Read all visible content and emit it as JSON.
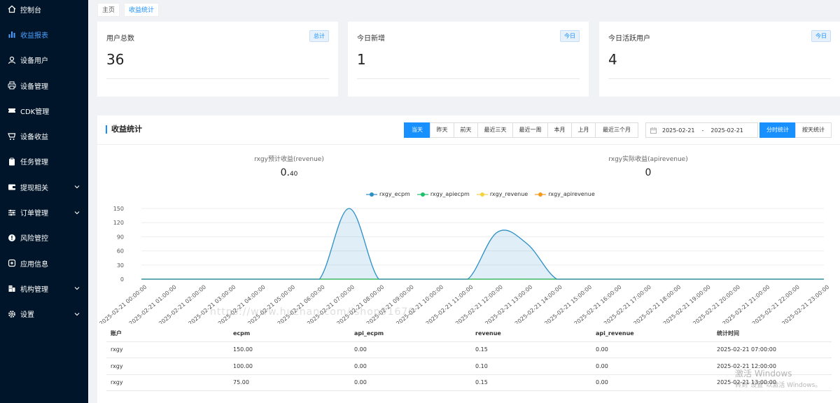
{
  "sidebar": {
    "items": [
      {
        "label": "控制台",
        "icon": "home-icon"
      },
      {
        "label": "收益报表",
        "icon": "bar-chart-icon",
        "active": true
      },
      {
        "label": "设备用户",
        "icon": "user-icon"
      },
      {
        "label": "设备管理",
        "icon": "printer-icon"
      },
      {
        "label": "CDK管理",
        "icon": "ticket-icon"
      },
      {
        "label": "设备收益",
        "icon": "cart-icon"
      },
      {
        "label": "任务管理",
        "icon": "clipboard-icon"
      },
      {
        "label": "提现相关",
        "icon": "wallet-icon",
        "expandable": true
      },
      {
        "label": "订单管理",
        "icon": "sliders-icon",
        "expandable": true
      },
      {
        "label": "风险管控",
        "icon": "alert-icon"
      },
      {
        "label": "应用信息",
        "icon": "apps-icon"
      },
      {
        "label": "机构管理",
        "icon": "building-icon",
        "expandable": true
      },
      {
        "label": "设置",
        "icon": "gear-icon",
        "expandable": true
      }
    ]
  },
  "breadcrumb": [
    "主页",
    "收益统计"
  ],
  "stats": [
    {
      "title": "用户总数",
      "badge": "总计",
      "value": "36"
    },
    {
      "title": "今日新增",
      "badge": "今日",
      "value": "1"
    },
    {
      "title": "今日活跃用户",
      "badge": "今日",
      "value": "4"
    }
  ],
  "panel": {
    "title": "收益统计",
    "tabs": [
      "当天",
      "昨天",
      "前天",
      "最近三天",
      "最近一周",
      "本月",
      "上月",
      "最近三个月"
    ],
    "date_start": "2025-02-21",
    "date_sep": "-",
    "date_end": "2025-02-21",
    "mode_tabs": [
      "分时统计",
      "按天统计"
    ],
    "summary": [
      {
        "label": "rxgy预计收益(revenue)",
        "value_main": "0.",
        "value_small": "40"
      },
      {
        "label": "rxgy实际收益(apirevenue)",
        "value_main": "0",
        "value_small": ""
      }
    ]
  },
  "chart_data": {
    "type": "area",
    "x": [
      "2025-02-21 00:00:00",
      "2025-02-21 01:00:00",
      "2025-02-21 02:00:00",
      "2025-02-21 03:00:00",
      "2025-02-21 04:00:00",
      "2025-02-21 05:00:00",
      "2025-02-21 06:00:00",
      "2025-02-21 07:00:00",
      "2025-02-21 08:00:00",
      "2025-02-21 09:00:00",
      "2025-02-21 10:00:00",
      "2025-02-21 11:00:00",
      "2025-02-21 12:00:00",
      "2025-02-21 13:00:00",
      "2025-02-21 14:00:00",
      "2025-02-21 15:00:00",
      "2025-02-21 16:00:00",
      "2025-02-21 17:00:00",
      "2025-02-21 18:00:00",
      "2025-02-21 19:00:00",
      "2025-02-21 20:00:00",
      "2025-02-21 21:00:00",
      "2025-02-21 22:00:00",
      "2025-02-21 23:00:00"
    ],
    "y_ticks": [
      0,
      30,
      60,
      90,
      120,
      150
    ],
    "ylim": [
      0,
      150
    ],
    "grid": true,
    "legend_position": "top-center",
    "series": [
      {
        "name": "rxgy_ecpm",
        "color": "#2b8fc6",
        "values": [
          0,
          0,
          0,
          0,
          0,
          0,
          0,
          150,
          0,
          0,
          0,
          0,
          100,
          75,
          0,
          0,
          0,
          0,
          0,
          0,
          0,
          0,
          0,
          0
        ]
      },
      {
        "name": "rxgy_apiecpm",
        "color": "#1cbf6a",
        "values": [
          0,
          0,
          0,
          0,
          0,
          0,
          0,
          0,
          0,
          0,
          0,
          0,
          0,
          0,
          0,
          0,
          0,
          0,
          0,
          0,
          0,
          0,
          0,
          0
        ]
      },
      {
        "name": "rxgy_revenue",
        "color": "#f5d33f",
        "values": [
          0,
          0,
          0,
          0,
          0,
          0,
          0,
          0.15,
          0,
          0,
          0,
          0,
          0.1,
          0.15,
          0,
          0,
          0,
          0,
          0,
          0,
          0,
          0,
          0,
          0
        ]
      },
      {
        "name": "rxgy_apirevenue",
        "color": "#f29a1a",
        "values": [
          0,
          0,
          0,
          0,
          0,
          0,
          0,
          0,
          0,
          0,
          0,
          0,
          0,
          0,
          0,
          0,
          0,
          0,
          0,
          0,
          0,
          0,
          0,
          0
        ]
      }
    ]
  },
  "table": {
    "headers": [
      "账户",
      "ecpm",
      "api_ecpm",
      "revenue",
      "api_revenue",
      "统计时间"
    ],
    "rows": [
      [
        "rxgy",
        "150.00",
        "0.00",
        "0.15",
        "0.00",
        "2025-02-21 07:00:00"
      ],
      [
        "rxgy",
        "100.00",
        "0.00",
        "0.10",
        "0.00",
        "2025-02-21 12:00:00"
      ],
      [
        "rxgy",
        "75.00",
        "0.00",
        "0.15",
        "0.00",
        "2025-02-21 13:00:00"
      ]
    ]
  },
  "watermark": "https://www.huzhan.com/ishop51679",
  "windows_activation": {
    "line1": "激活 Windows",
    "line2": "转到\"设置\"以激活 Windows。"
  }
}
